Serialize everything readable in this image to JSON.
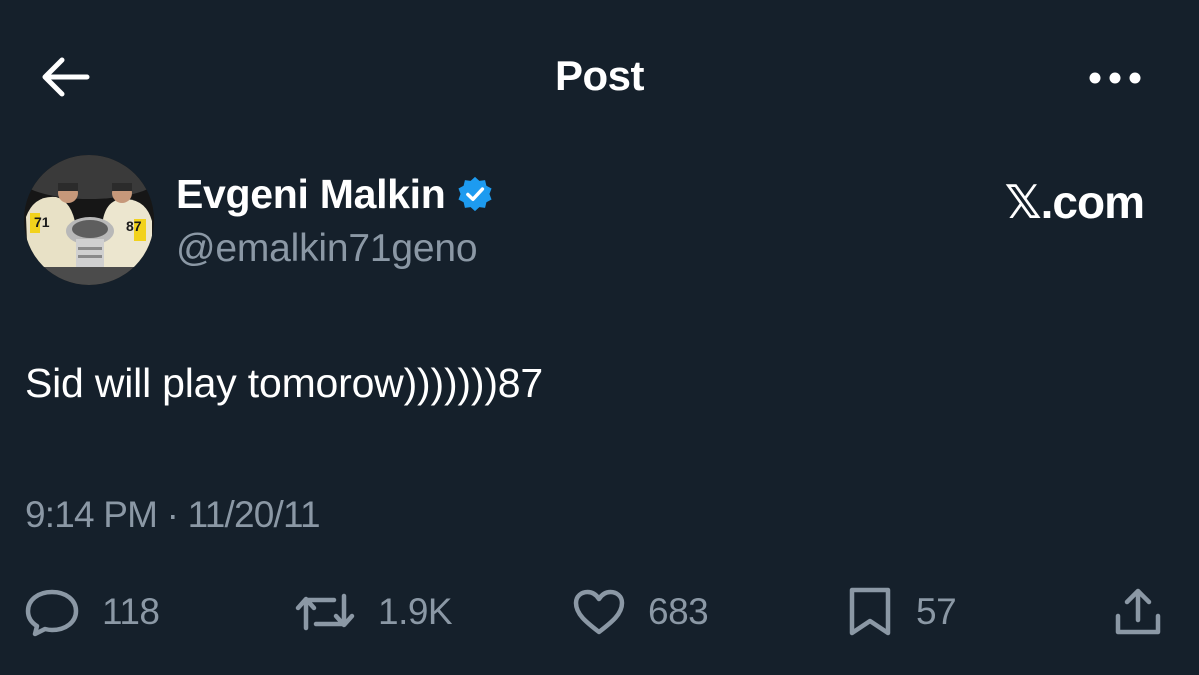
{
  "header": {
    "title": "Post",
    "back_icon": "arrow-left-icon",
    "more_icon": "more-horizontal-icon"
  },
  "author": {
    "display_name": "Evgeni Malkin",
    "handle": "@emalkin71geno",
    "verified": true,
    "verified_color": "#1d9bf0"
  },
  "brand": "𝕏.com",
  "post": {
    "text": "Sid will play tomorow)))))))87",
    "timestamp": "9:14 PM · 11/20/11"
  },
  "actions": {
    "reply_count": "118",
    "repost_count": "1.9K",
    "like_count": "683",
    "bookmark_count": "57"
  },
  "colors": {
    "background": "#15202b",
    "text": "#ffffff",
    "secondary": "#8b98a5",
    "accent": "#1d9bf0"
  }
}
